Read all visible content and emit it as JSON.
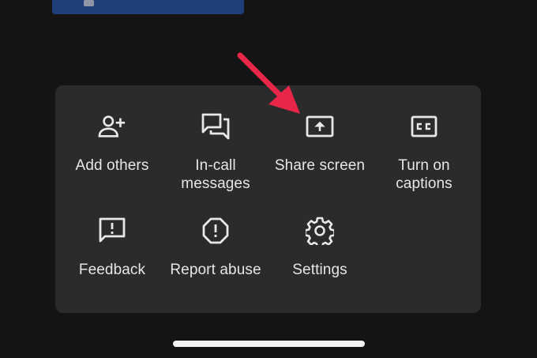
{
  "menu": {
    "items": [
      {
        "label": "Add others",
        "icon": "person-add-icon"
      },
      {
        "label": "In-call\nmessages",
        "icon": "chat-icon"
      },
      {
        "label": "Share screen",
        "icon": "present-screen-icon"
      },
      {
        "label": "Turn on\ncaptions",
        "icon": "closed-captions-icon"
      },
      {
        "label": "Feedback",
        "icon": "feedback-icon"
      },
      {
        "label": "Report abuse",
        "icon": "report-icon"
      },
      {
        "label": "Settings",
        "icon": "settings-gear-icon"
      }
    ]
  },
  "colors": {
    "background": "#141414",
    "sheet": "#2b2b2b",
    "text": "#e6e6e6",
    "annotation_arrow": "#e8264a",
    "video_tile": "#1f3f7a"
  }
}
